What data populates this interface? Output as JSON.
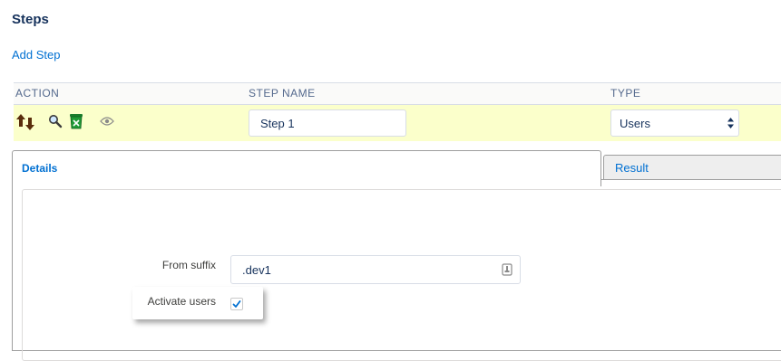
{
  "page": {
    "title": "Steps"
  },
  "toolbar": {
    "add_step_label": "Add Step"
  },
  "table": {
    "headers": {
      "action": "ACTION",
      "step_name": "STEP NAME",
      "type": "TYPE"
    },
    "rows": [
      {
        "action_icons": [
          "move-icon",
          "search-icon",
          "delete-icon",
          "view-icon"
        ],
        "step_name": "Step 1",
        "type": "Users",
        "highlight_color": "#fbffcb"
      }
    ]
  },
  "tabs": {
    "details": "Details",
    "result": "Result",
    "active": "Details"
  },
  "form": {
    "from_suffix_label": "From suffix",
    "from_suffix_value": ".dev1",
    "activate_users_label": "Activate users",
    "activate_users_checked": true
  },
  "colors": {
    "link": "#0070d2",
    "title": "#16325c",
    "row_highlight": "#fbffcb"
  }
}
